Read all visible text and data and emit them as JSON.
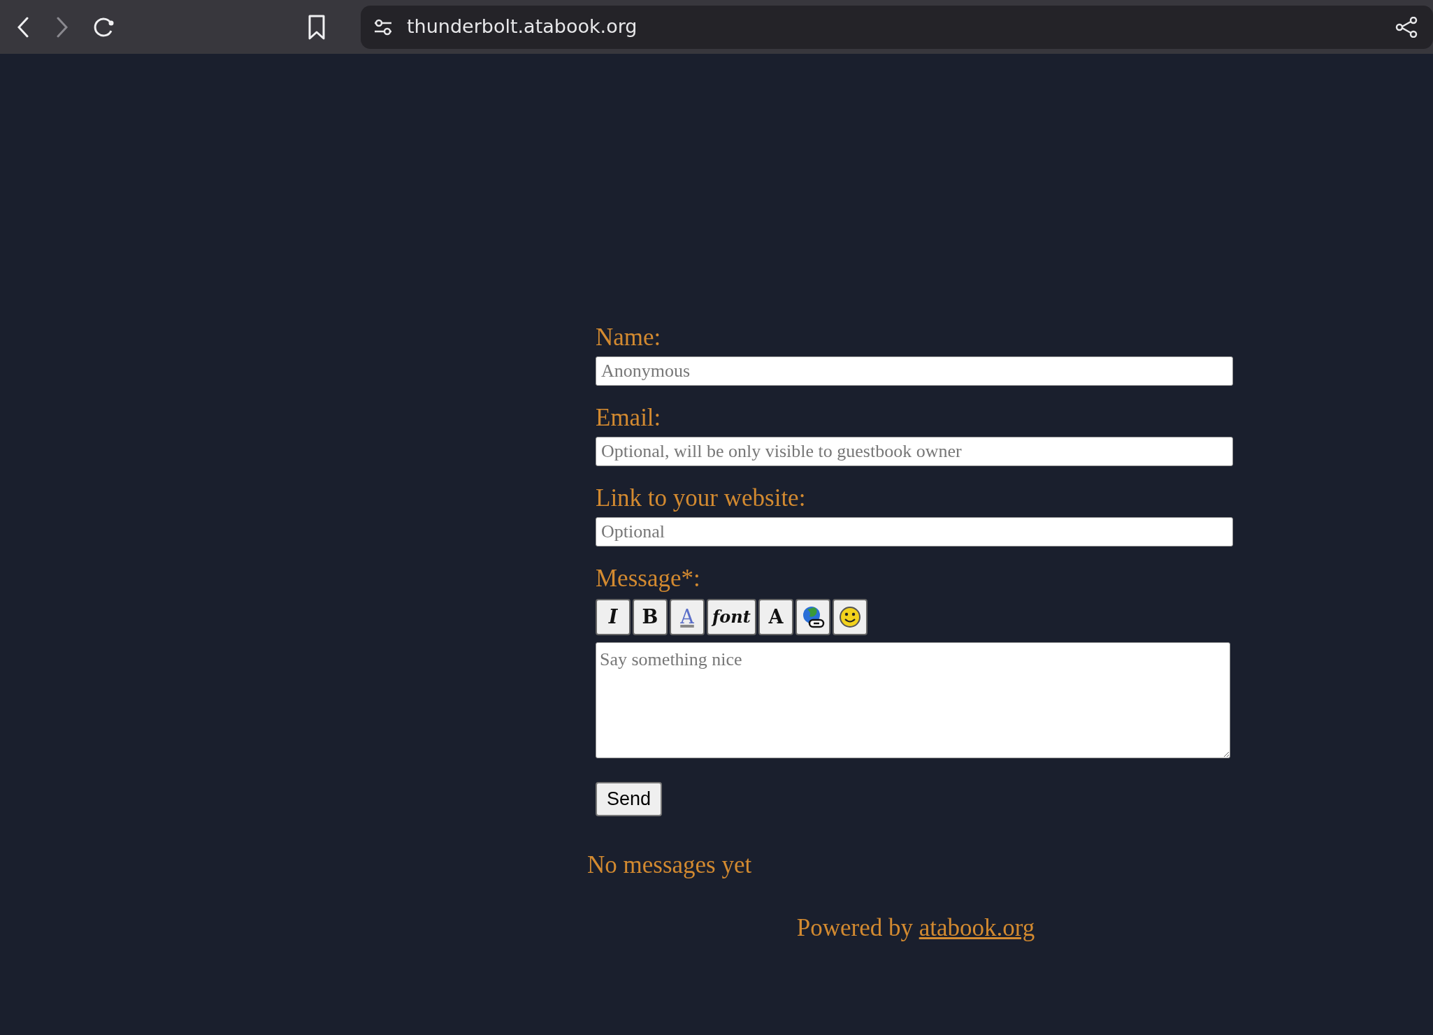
{
  "browser": {
    "nav_buttons": [
      {
        "kind": "back",
        "disabled": false
      },
      {
        "kind": "forward",
        "disabled": true
      },
      {
        "kind": "reload",
        "disabled": false
      }
    ],
    "url": "thunderbolt.atabook.org"
  },
  "form": {
    "fields": [
      {
        "label": "Name:",
        "placeholder": "Anonymous"
      },
      {
        "label": "Email:",
        "placeholder": "Optional, will be only visible to guestbook owner"
      },
      {
        "label": "Link to your website:",
        "placeholder": "Optional"
      }
    ],
    "message": {
      "label": "Message*:",
      "placeholder": "Say something nice"
    },
    "toolbar": [
      {
        "kind": "italic",
        "text": "I"
      },
      {
        "kind": "bold",
        "text": "B"
      },
      {
        "kind": "color",
        "text": "A"
      },
      {
        "kind": "font",
        "text": "font"
      },
      {
        "kind": "size",
        "text": "A"
      },
      {
        "kind": "link"
      },
      {
        "kind": "smiley"
      }
    ],
    "submit": "Send"
  },
  "empty_notice": "No messages yet",
  "footer": {
    "text": "Powered by",
    "link": "atabook.org"
  }
}
